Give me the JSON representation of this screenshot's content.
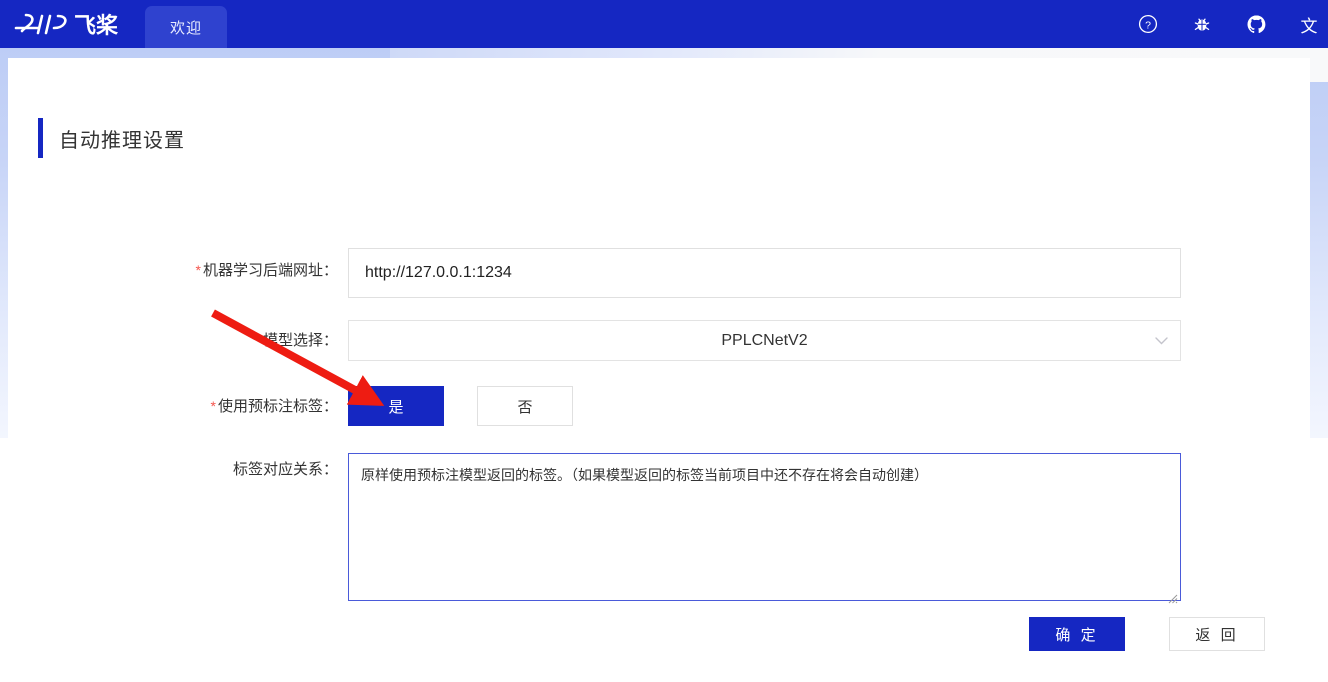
{
  "colors": {
    "brand_blue": "#1527c2",
    "tab_blue": "#2f42cf",
    "required_red": "#f5544c",
    "annotation_red": "#ee1c12",
    "textarea_border": "#4a5ad9"
  },
  "topbar": {
    "brand_text": "飞桨",
    "brand_logo": "paddlepaddle-logo",
    "tabs": [
      {
        "label": "欢迎",
        "active": true
      }
    ],
    "icons": [
      {
        "name": "help-circle-icon",
        "glyph": "?"
      },
      {
        "name": "bug-icon",
        "glyph": "bug"
      },
      {
        "name": "github-icon",
        "glyph": "github"
      },
      {
        "name": "language-icon",
        "glyph": "文"
      }
    ]
  },
  "page": {
    "title": "自动推理设置"
  },
  "form": {
    "rows": [
      {
        "label": "机器学习后端网址：",
        "required": true,
        "type": "text",
        "value": "http://127.0.0.1:1234",
        "placeholder": ""
      },
      {
        "label": "模型选择：",
        "required": false,
        "type": "select",
        "value": "PPLCNetV2",
        "arrow": "chevron-down-icon"
      },
      {
        "label": "使用预标注标签：",
        "required": true,
        "type": "radio",
        "options": [
          {
            "label": "是",
            "selected": true
          },
          {
            "label": "否",
            "selected": false
          }
        ]
      },
      {
        "label": "标签对应关系：",
        "required": false,
        "type": "textarea",
        "value": "原样使用预标注模型返回的标签。（如果模型返回的标签当前项目中还不存在将会自动创建）",
        "placeholder": ""
      }
    ]
  },
  "actions": {
    "confirm_label": "确 定",
    "back_label": "返 回"
  },
  "annotation": {
    "type": "red-arrow",
    "points_to": "使用预标注标签 是 按钮"
  }
}
